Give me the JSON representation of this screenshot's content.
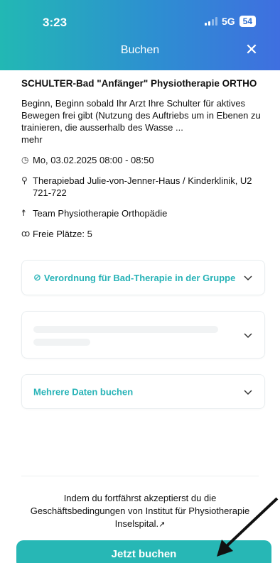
{
  "status_bar": {
    "time": "3:23",
    "network": "5G",
    "battery": "54"
  },
  "header": {
    "title": "Buchen",
    "close_icon": "close-icon"
  },
  "course": {
    "title": "SCHULTER-Bad \"Anfänger\" Physiotherapie ORTHO",
    "description": "Beginn, Beginn sobald Ihr Arzt Ihre Schulter für aktives Bewegen frei gibt (Nutzung des Auftriebs um in Ebenen zu trainieren, die ausserhalb des Wasse ...",
    "more_link": "mehr",
    "datetime": "Mo, 03.02.2025 08:00 - 08:50",
    "location": "Therapiebad Julie-von-Jenner-Haus / Kinderklinik, U2 721-722",
    "team": "Team Physiotherapie Orthopädie",
    "free_spots": "Freie Plätze: 5"
  },
  "sections": {
    "prescription_label": "Verordnung für Bad-Therapie in der Gruppe",
    "multiple_dates_label": "Mehrere Daten buchen"
  },
  "footer": {
    "terms_text": "Indem du fortfährst akzeptierst du die Geschäftsbedingungen von Institut für Physiotherapie Inselspital.",
    "book_button": "Jetzt buchen"
  },
  "colors": {
    "accent": "#27b7b5",
    "gradient_start": "#22b8b4",
    "gradient_end": "#3f6fe0"
  }
}
